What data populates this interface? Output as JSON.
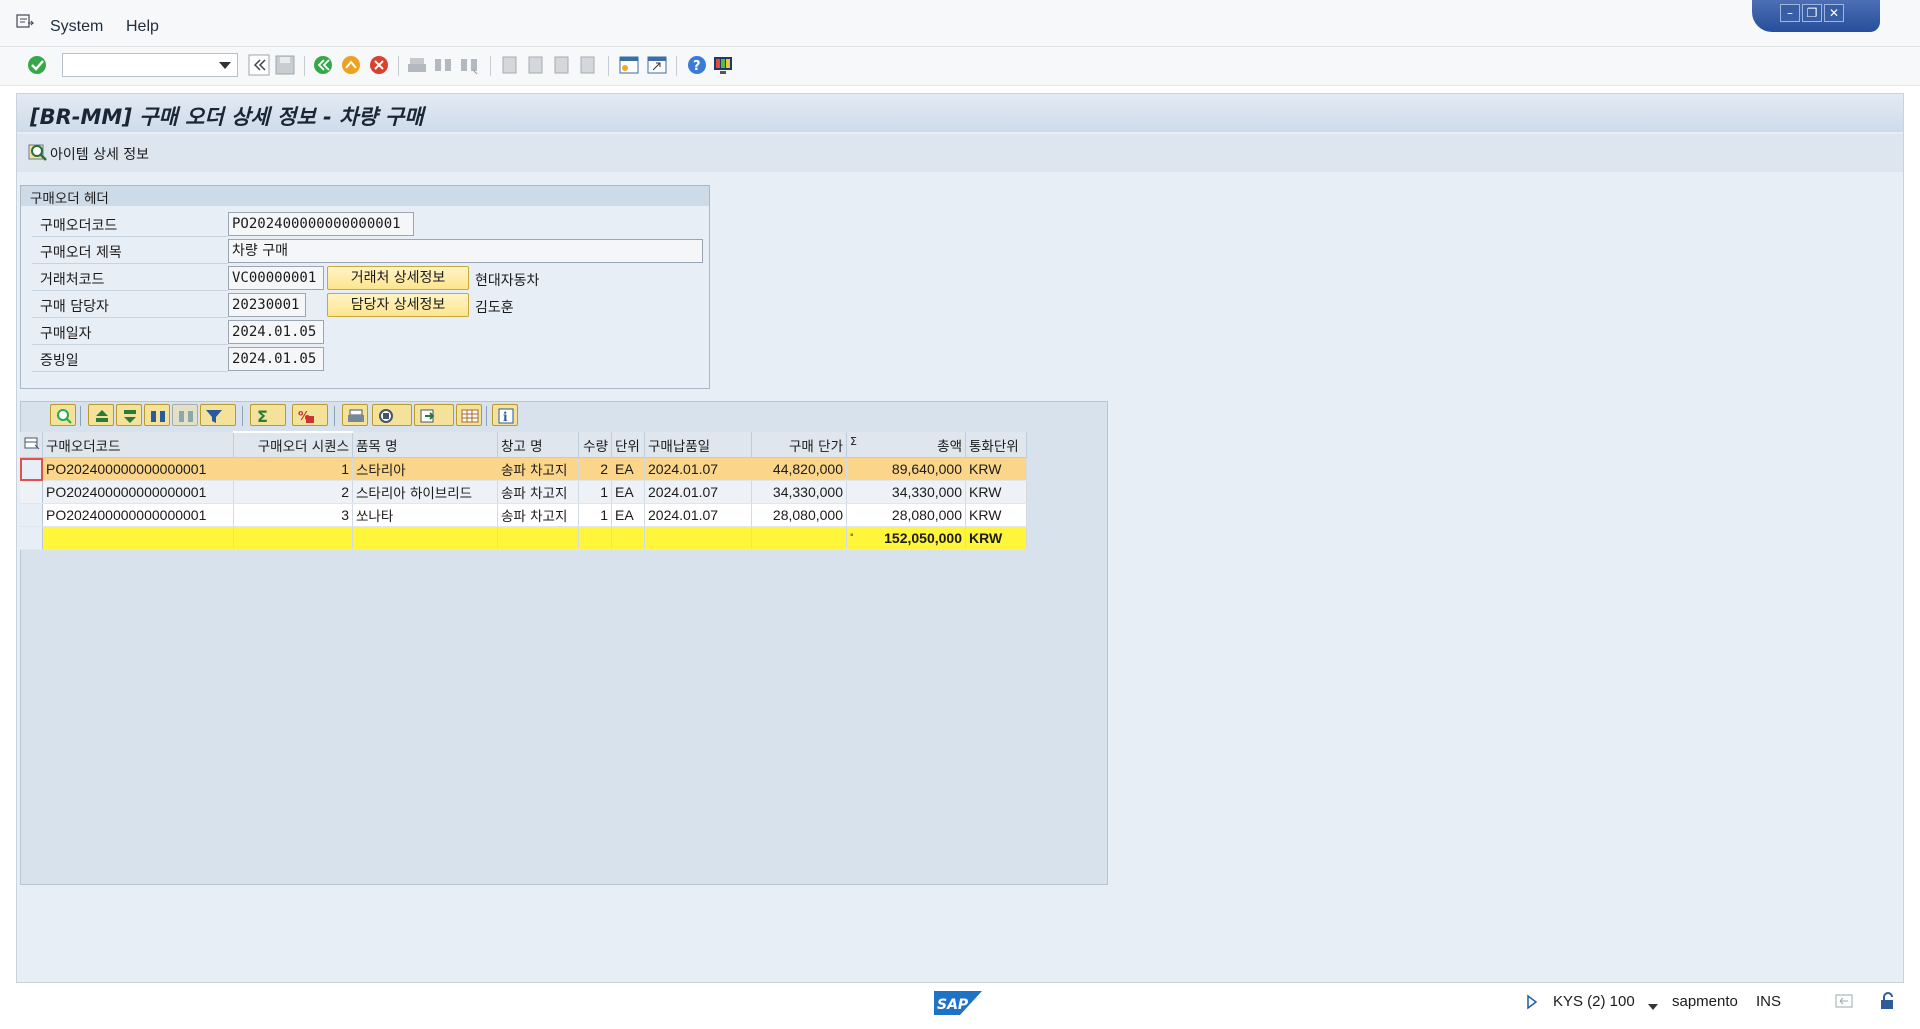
{
  "menu": {
    "system": "System",
    "help": "Help"
  },
  "title": "[BR-MM] 구매 오더 상세 정보 - 차량 구매",
  "app_toolbar": {
    "item_detail": "아이템 상세 정보"
  },
  "header": {
    "caption": "구매오더 헤더",
    "labels": {
      "po_code": "구매오더코드",
      "po_title": "구매오더 제목",
      "vendor_code": "거래처코드",
      "buyer": "구매 담당자",
      "po_date": "구매일자",
      "doc_date": "증빙일"
    },
    "values": {
      "po_code": "PO202400000000000001",
      "po_title": "차량 구매",
      "vendor_code": "VC00000001",
      "vendor_name": "현대자동차",
      "buyer": "20230001",
      "buyer_name": "김도훈",
      "po_date": "2024.01.05",
      "doc_date": "2024.01.05"
    },
    "buttons": {
      "vendor_detail": "거래처 상세정보",
      "buyer_detail": "담당자 상세정보"
    }
  },
  "grid": {
    "columns": [
      "구매오더코드",
      "구매오더 시퀀스",
      "품목 명",
      "창고 명",
      "수량",
      "단위",
      "구매납품일",
      "구매 단가",
      "총액",
      "통화단위"
    ],
    "rows": [
      [
        "PO202400000000000001",
        "1",
        "스타리아",
        "송파 차고지",
        "2",
        "EA",
        "2024.01.07",
        "44,820,000",
        "89,640,000",
        "KRW"
      ],
      [
        "PO202400000000000001",
        "2",
        "스타리아 하이브리드",
        "송파 차고지",
        "1",
        "EA",
        "2024.01.07",
        "34,330,000",
        "34,330,000",
        "KRW"
      ],
      [
        "PO202400000000000001",
        "3",
        "쏘나타",
        "송파 차고지",
        "1",
        "EA",
        "2024.01.07",
        "28,080,000",
        "28,080,000",
        "KRW"
      ]
    ],
    "total": {
      "amount": "152,050,000",
      "currency": "KRW"
    }
  },
  "status": {
    "system": "KYS (2) 100",
    "server": "sapmento",
    "mode": "INS"
  },
  "colors": {
    "highlight_row": "#fbd68a",
    "sum_row": "#fff53a",
    "title_bar": "#cddbe9"
  }
}
